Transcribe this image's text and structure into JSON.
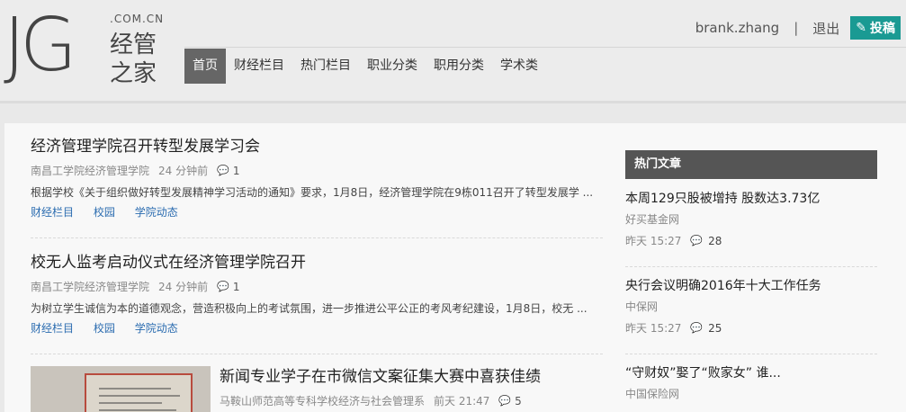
{
  "logo": {
    "jg": "JG",
    "domain": ".COM.CN",
    "line1": "经管",
    "line2": "之家"
  },
  "user": {
    "name": "brank.zhang",
    "separator": "|",
    "logout": "退出",
    "submit": "投稿"
  },
  "nav": [
    "首页",
    "财经栏目",
    "热门栏目",
    "职业分类",
    "职用分类",
    "学术类"
  ],
  "articles": [
    {
      "title": "经济管理学院召开转型发展学习会",
      "source": "南昌工学院经济管理学院",
      "time": "24 分钟前",
      "comments": "1",
      "summary": "根据学校《关于组织做好转型发展精神学习活动的通知》要求，1月8日，经济管理学院在9栋011召开了转型发展学 ...",
      "tags": [
        "财经栏目",
        "校园",
        "学院动态"
      ]
    },
    {
      "title": "校无人监考启动仪式在经济管理学院召开",
      "source": "南昌工学院经济管理学院",
      "time": "24 分钟前",
      "comments": "1",
      "summary": "为树立学生诚信为本的道德观念，营造积极向上的考试氛围，进一步推进公平公正的考风考纪建设，1月8日，校无 ...",
      "tags": [
        "财经栏目",
        "校园",
        "学院动态"
      ]
    },
    {
      "title": "新闻专业学子在市微信文案征集大赛中喜获佳绩",
      "source": "马鞍山师范高等专科学校经济与社会管理系",
      "time": "前天 21:47",
      "comments": "5"
    }
  ],
  "sidebar": {
    "heading": "热门文章",
    "items": [
      {
        "title": "本周129只股被增持 股数达3.73亿",
        "source": "好买基金网",
        "time": "昨天 15:27",
        "comments": "28"
      },
      {
        "title": "央行会议明确2016年十大工作任务",
        "source": "中保网",
        "time": "昨天 15:27",
        "comments": "25"
      },
      {
        "title": "“守财奴”娶了“败家女” 谁...",
        "source": "中国保险网"
      }
    ]
  },
  "icons": {
    "comment": "comment-icon",
    "pen": "pen-icon"
  },
  "colors": {
    "accent": "#1a9a93",
    "nav_active": "#666666",
    "sidebar_head": "#555555",
    "tag_link": "#2b6cb0"
  }
}
